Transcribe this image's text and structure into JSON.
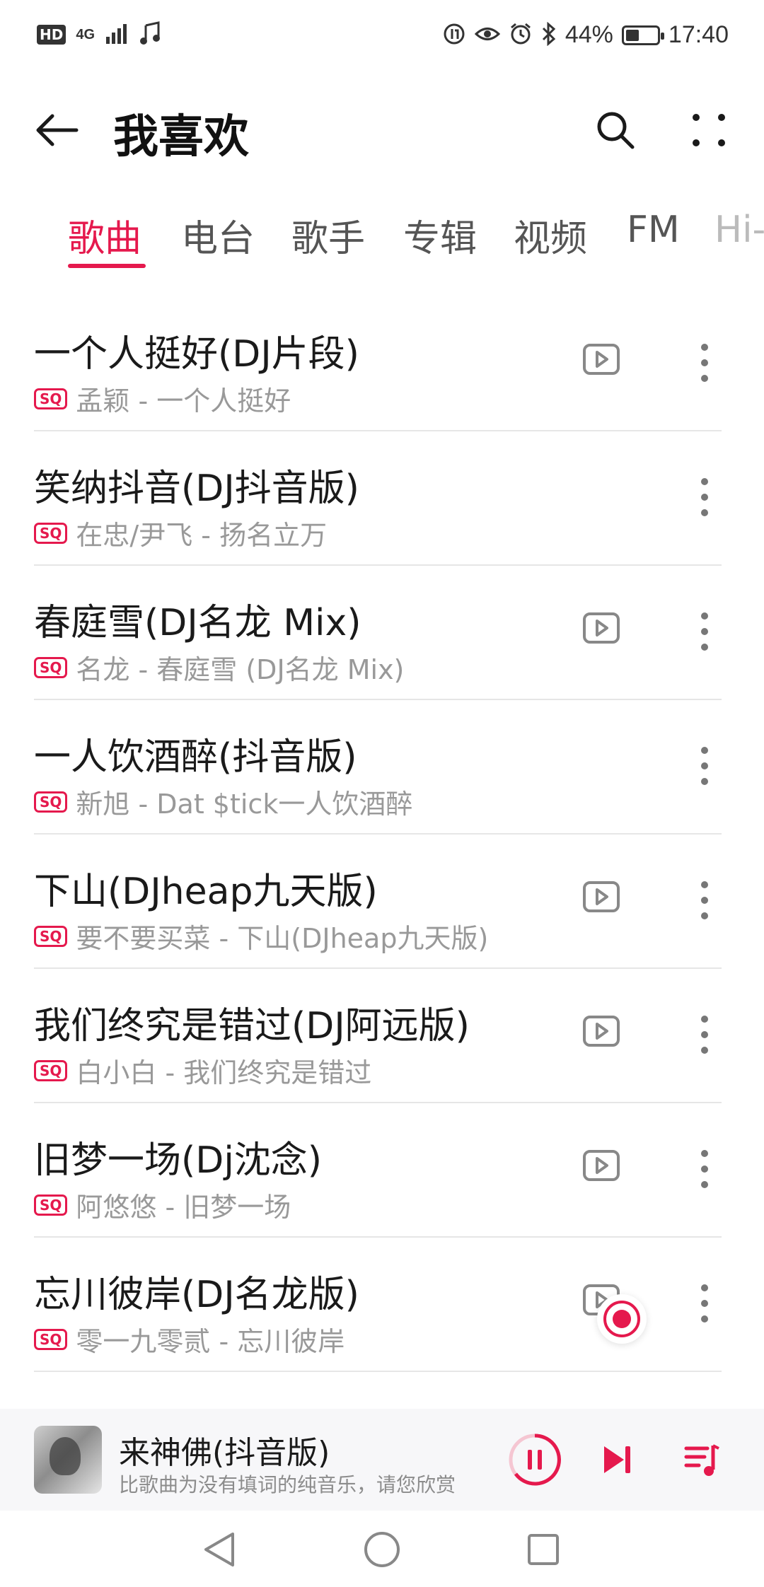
{
  "status_bar": {
    "hd": "HD",
    "network": "4G",
    "battery_percent": "44%",
    "battery_level": 0.44,
    "time": "17:40"
  },
  "header": {
    "title": "我喜欢"
  },
  "tabs": [
    {
      "label": "歌曲",
      "active": true
    },
    {
      "label": "电台",
      "active": false
    },
    {
      "label": "歌手",
      "active": false
    },
    {
      "label": "专辑",
      "active": false
    },
    {
      "label": "视频",
      "active": false
    },
    {
      "label": "FM",
      "active": false
    },
    {
      "label": "Hi-",
      "active": false
    }
  ],
  "songs": [
    {
      "title": "一个人挺好(DJ片段)",
      "badge": "SQ",
      "meta": "孟颖 - 一个人挺好",
      "has_mv": true
    },
    {
      "title": "笑纳抖音(DJ抖音版)",
      "badge": "SQ",
      "meta": "在忠/尹飞 - 扬名立万",
      "has_mv": false
    },
    {
      "title": "春庭雪(DJ名龙 Mix)",
      "badge": "SQ",
      "meta": "名龙 - 春庭雪 (DJ名龙 Mix)",
      "has_mv": true
    },
    {
      "title": "一人饮酒醉(抖音版)",
      "badge": "SQ",
      "meta": "新旭 - Dat $tick一人饮酒醉",
      "has_mv": false
    },
    {
      "title": "下山(DJheap九天版)",
      "badge": "SQ",
      "meta": "要不要买菜 - 下山(DJheap九天版)",
      "has_mv": true
    },
    {
      "title": "我们终究是错过(DJ阿远版)",
      "badge": "SQ",
      "meta": "白小白 - 我们终究是错过",
      "has_mv": true
    },
    {
      "title": "旧梦一场(Dj沈念)",
      "badge": "SQ",
      "meta": "阿悠悠 - 旧梦一场",
      "has_mv": true
    },
    {
      "title": "忘川彼岸(DJ名龙版)",
      "badge": "SQ",
      "meta": "零一九零贰 - 忘川彼岸",
      "has_mv": true
    }
  ],
  "now_playing": {
    "title": "来神佛(抖音版)",
    "subtitle": "比歌曲为没有填词的纯音乐，请您欣赏"
  },
  "colors": {
    "accent": "#e5194d",
    "text_primary": "#1a1a1a",
    "text_secondary": "#999999"
  }
}
